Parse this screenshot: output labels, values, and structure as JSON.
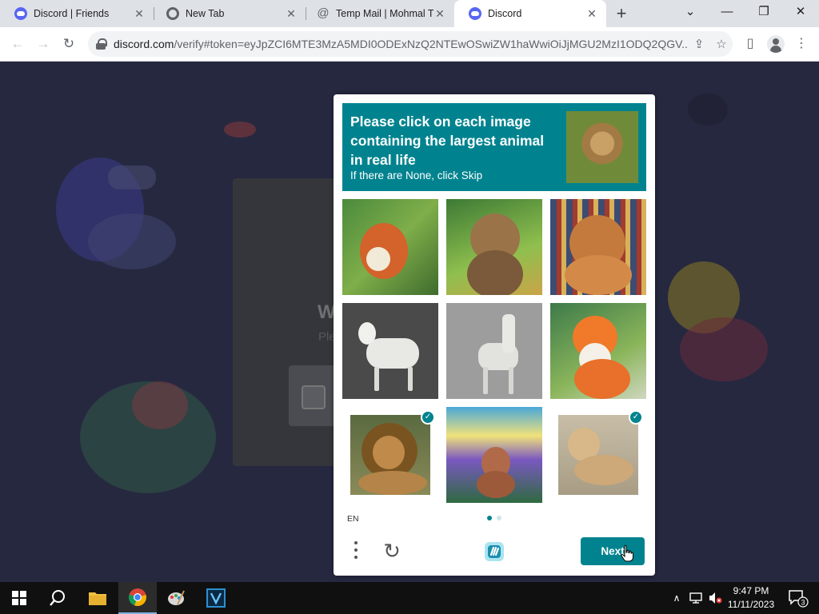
{
  "browser": {
    "tabs": [
      {
        "title": "Discord | Friends",
        "icon": "discord-icon",
        "active": false
      },
      {
        "title": "New Tab",
        "icon": "chrome-icon",
        "active": false
      },
      {
        "title": "Temp Mail | Mohmal T",
        "icon": "at-sign-icon",
        "active": false
      },
      {
        "title": "Discord",
        "icon": "discord-icon",
        "active": true
      }
    ],
    "new_tab_label": "+",
    "url_domain": "discord.com",
    "url_rest": "/verify#token=eyJpZCI6MTE3MzA5MDI0ODExNzQ2NTEwOSwiZW1haWwiOiJjMGU2MzI1ODQ2QGV..."
  },
  "background_page": {
    "heading_partial": "W",
    "subtext_partial": "Ple"
  },
  "captcha": {
    "prompt_line": "Please click on each image containing the largest animal in real life",
    "prompt_sub": "If there are None, click Skip",
    "language": "EN",
    "next_label": "Next",
    "accent_color": "#00838f",
    "tiles": [
      {
        "subject": "fox painting",
        "selected": false
      },
      {
        "subject": "cat in forest painting",
        "selected": false
      },
      {
        "subject": "dog in library painting",
        "selected": false
      },
      {
        "subject": "white goat",
        "selected": false
      },
      {
        "subject": "white llama sculpture",
        "selected": false
      },
      {
        "subject": "fox watercolor",
        "selected": false
      },
      {
        "subject": "roaring lion",
        "selected": true
      },
      {
        "subject": "cat under rainbow painting",
        "selected": false
      },
      {
        "subject": "lioness lying",
        "selected": true
      }
    ]
  },
  "taskbar": {
    "time": "9:47 PM",
    "date": "11/11/2023",
    "notification_count": "3",
    "pinned": [
      "start",
      "search",
      "file-explorer",
      "chrome",
      "paint",
      "vscode-like-v"
    ]
  }
}
